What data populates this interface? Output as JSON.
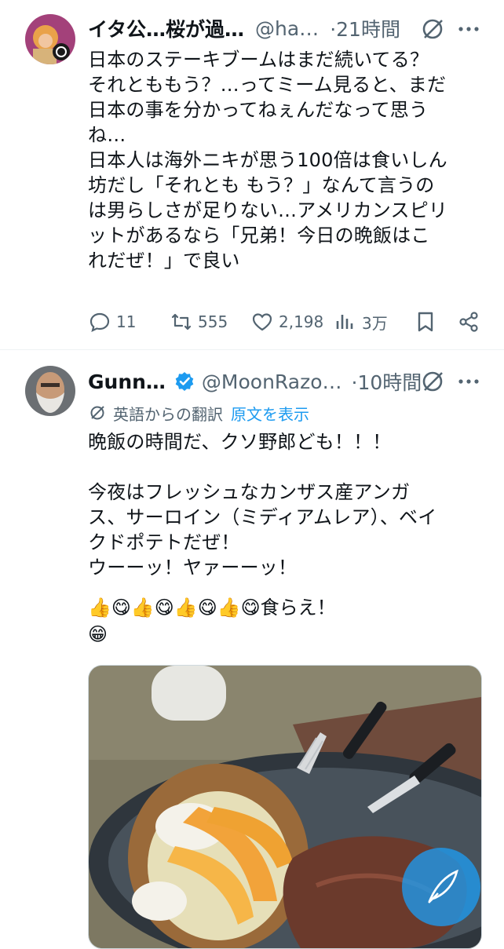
{
  "tweets": [
    {
      "display_name": "イタ公…桜が過…",
      "handle": "@ha…",
      "time": "·21時間",
      "body": "日本のステーキブームはまだ続いてる？\nそれとももう？…ってミーム見ると、まだ\n日本の事を分かってねぇんだなって思う\nね…\n日本人は海外ニキが思う100倍は食いしん\n坊だし「それとも もう？」なんて言うの\nは男らしさが足りない…アメリカンスピリ\nットがあるなら「兄弟！今日の晩飯はこ\nれだぜ！」で良い",
      "stats": {
        "replies": "11",
        "reposts": "555",
        "likes": "2,198",
        "views": "3万"
      }
    },
    {
      "display_name": "Gunn…",
      "handle": "@MoonRazo…",
      "time": "·10時間",
      "verified": true,
      "translation_label": "英語からの翻訳",
      "translation_link": "原文を表示",
      "body": "晩飯の時間だ、クソ野郎ども！！！\n\n今夜はフレッシュなカンザス産アンガ\nス、サーロイン（ミディアムレア）、ベイ\nクドポテトだぜ！\nウーーッ！ヤァーーッ！",
      "emoji_line_1": "👍😋👍😋👍😋👍😋食らえ！",
      "emoji_line_2": "😁"
    }
  ],
  "icons": {
    "reply": "reply-icon",
    "repost": "repost-icon",
    "like": "heart-icon",
    "views": "views-icon",
    "bookmark": "bookmark-icon",
    "share": "share-icon",
    "grok": "grok-icon",
    "more": "more-icon",
    "verified": "verified-badge-icon"
  },
  "colors": {
    "text": "#0f1419",
    "muted": "#536471",
    "link": "#1d9bf0",
    "verified": "#1d9bf0"
  }
}
